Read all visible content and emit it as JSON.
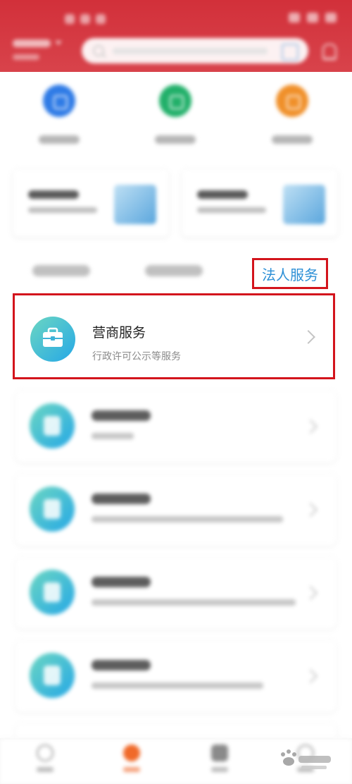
{
  "header": {
    "location": "",
    "search_placeholder": ""
  },
  "quick_actions": [
    {
      "label": "",
      "color": "#2f7be6",
      "icon": "document-icon"
    },
    {
      "label": "",
      "color": "#22b06a",
      "icon": "chat-icon"
    },
    {
      "label": "",
      "color": "#f0902a",
      "icon": "home-icon"
    }
  ],
  "promos": [
    {
      "title": "",
      "subtitle": ""
    },
    {
      "title": "",
      "subtitle": ""
    }
  ],
  "tabs": [
    {
      "label": "",
      "active": false
    },
    {
      "label": "",
      "active": false
    },
    {
      "label": "法人服务",
      "active": true
    }
  ],
  "featured_service": {
    "title": "营商服务",
    "subtitle": "行政许可公示等服务"
  },
  "services": [
    {
      "title": "",
      "subtitle": "",
      "icon": "hand-money-icon"
    },
    {
      "title": "",
      "subtitle": "",
      "icon": "certificate-icon"
    },
    {
      "title": "",
      "subtitle": "",
      "icon": "award-icon"
    },
    {
      "title": "",
      "subtitle": "",
      "icon": "shield-icon"
    }
  ],
  "bottom_nav": [
    {
      "label": "",
      "active": false
    },
    {
      "label": "",
      "active": true
    },
    {
      "label": "",
      "active": false
    },
    {
      "label": "",
      "active": false
    }
  ],
  "colors": {
    "header_red": "#d2303a",
    "highlight_red": "#d3141c",
    "active_tab_blue": "#2c8fd6",
    "active_nav_orange": "#f06a2a"
  }
}
